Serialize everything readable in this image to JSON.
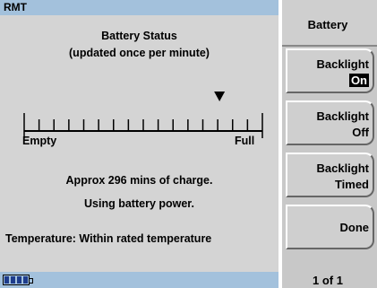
{
  "header": {
    "title": "RMT"
  },
  "main": {
    "status_title": "Battery Status",
    "update_note": "(updated once per minute)",
    "gauge": {
      "label_empty": "Empty",
      "label_full": "Full",
      "level_fraction": 0.82,
      "tick_count": 16
    },
    "charge_text": "Approx 296 mins of charge.",
    "power_text": "Using battery power.",
    "temperature_text": "Temperature:  Within rated temperature"
  },
  "status_bar": {
    "battery_segments_filled": 4
  },
  "softkeys": {
    "menu_title": "Battery",
    "backlight_on": {
      "line1": "Backlight",
      "line2": "On"
    },
    "backlight_off": {
      "line1": "Backlight",
      "line2": "Off"
    },
    "backlight_timed": {
      "line1": "Backlight",
      "line2": "Timed"
    },
    "done": "Done",
    "page": "1 of 1"
  },
  "colors": {
    "bar": "#a3c1dc",
    "panel": "#d4d4d4",
    "softkey": "#cfcfcf"
  }
}
